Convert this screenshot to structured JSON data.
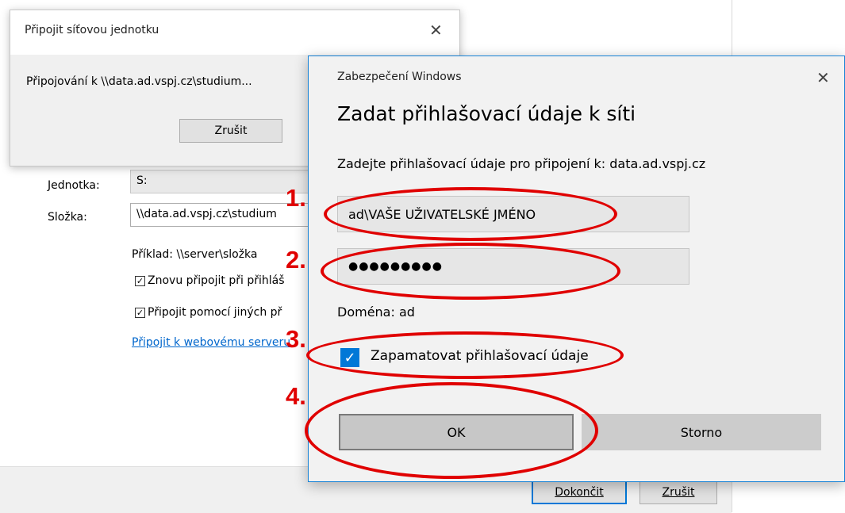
{
  "wizard": {
    "drive_label": "Jednotka:",
    "drive_value": "S:",
    "folder_label": "Složka:",
    "folder_value": "\\\\data.ad.vspj.cz\\studium",
    "example": "Příklad: \\\\server\\složka",
    "reconnect_label": "Znovu připojit při přihláš",
    "other_creds_label": "Připojit pomocí jiných př",
    "web_link": "Připojit k webovému serveru",
    "finish_button": "Dokončit",
    "cancel_button": "Zrušit"
  },
  "progress_dialog": {
    "title": "Připojit síťovou jednotku",
    "message": "Připojování k \\\\data.ad.vspj.cz\\studium...",
    "cancel_button": "Zrušit",
    "close_glyph": "✕"
  },
  "security_dialog": {
    "title": "Zabezpečení Windows",
    "close_glyph": "✕",
    "heading": "Zadat přihlašovací údaje k síti",
    "subheading": "Zadejte přihlašovací údaje pro připojení k: data.ad.vspj.cz",
    "username_value": "ad\\VAŠE UŽIVATELSKÉ JMÉNO",
    "password_value": "●●●●●●●●●",
    "domain_text": "Doména: ad",
    "remember_label": "Zapamatovat přihlašovací údaje",
    "remember_checked": true,
    "ok_button": "OK",
    "cancel_button": "Storno"
  },
  "annotations": {
    "step1": "1.",
    "step2": "2.",
    "step3": "3.",
    "step4": "4."
  },
  "colors": {
    "annotation_red": "#e00000",
    "accent_blue": "#0078d7",
    "dialog_bg": "#f2f2f2"
  }
}
